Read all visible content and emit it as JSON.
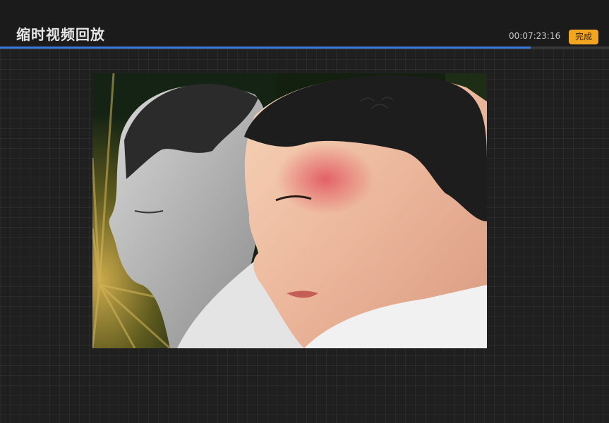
{
  "header": {
    "title": "缩时视频回放",
    "timestamp": "00:07:23:16",
    "done_label": "完成"
  },
  "playback": {
    "progress_fraction": 0.871
  },
  "colors": {
    "accent_progress": "#3b7be0",
    "done_button": "#f2a51f",
    "background": "#1f1f1f"
  },
  "video": {
    "content": "timelapse-painting-frame"
  }
}
